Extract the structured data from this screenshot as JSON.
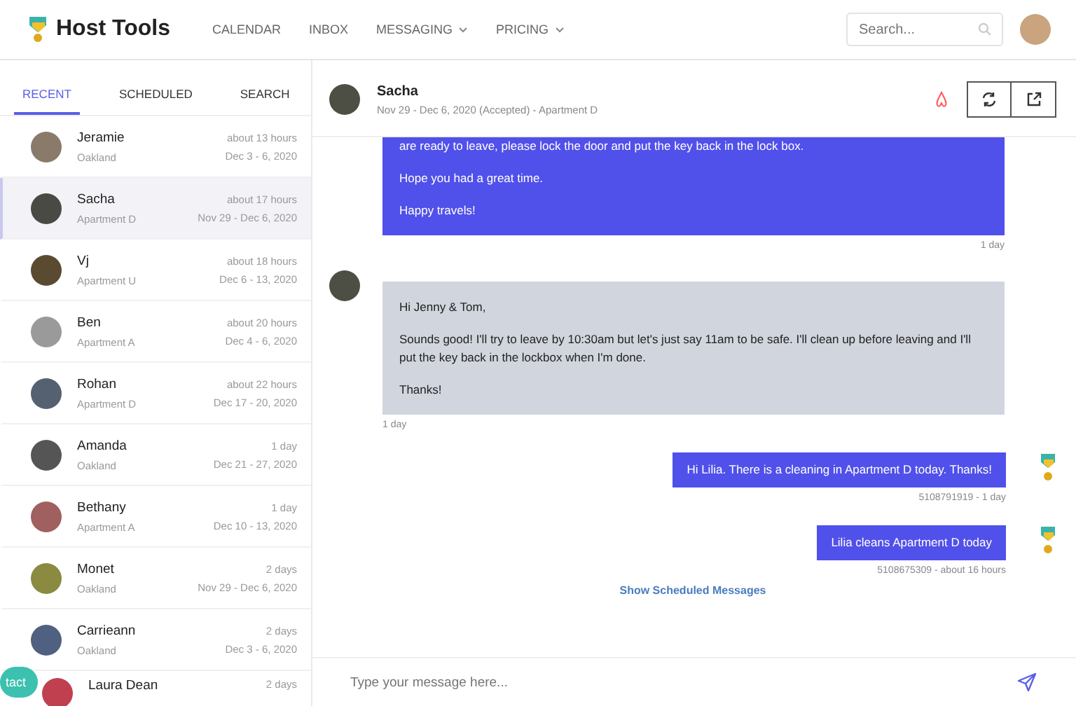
{
  "brand": {
    "name": "Host Tools"
  },
  "nav": [
    {
      "label": "CALENDAR",
      "dropdown": false
    },
    {
      "label": "INBOX",
      "dropdown": false
    },
    {
      "label": "MESSAGING",
      "dropdown": true
    },
    {
      "label": "PRICING",
      "dropdown": true
    }
  ],
  "search": {
    "placeholder": "Search..."
  },
  "tabs": [
    {
      "label": "RECENT",
      "selected": true
    },
    {
      "label": "SCHEDULED",
      "selected": false
    },
    {
      "label": "SEARCH",
      "selected": false
    }
  ],
  "conversations": [
    {
      "name": "Jeramie",
      "location": "Oakland",
      "time": "about 13 hours",
      "dates": "Dec 3 - 6, 2020",
      "selected": false
    },
    {
      "name": "Sacha",
      "location": "Apartment D",
      "time": "about 17 hours",
      "dates": "Nov 29 - Dec 6, 2020",
      "selected": true
    },
    {
      "name": "Vj",
      "location": "Apartment U",
      "time": "about 18 hours",
      "dates": "Dec 6 - 13, 2020",
      "selected": false
    },
    {
      "name": "Ben",
      "location": "Apartment A",
      "time": "about 20 hours",
      "dates": "Dec 4 - 6, 2020",
      "selected": false
    },
    {
      "name": "Rohan",
      "location": "Apartment D",
      "time": "about 22 hours",
      "dates": "Dec 17 - 20, 2020",
      "selected": false
    },
    {
      "name": "Amanda",
      "location": "Oakland",
      "time": "1 day",
      "dates": "Dec 21 - 27, 2020",
      "selected": false
    },
    {
      "name": "Bethany",
      "location": "Apartment A",
      "time": "1 day",
      "dates": "Dec 10 - 13, 2020",
      "selected": false
    },
    {
      "name": "Monet",
      "location": "Oakland",
      "time": "2 days",
      "dates": "Nov 29 - Dec 6, 2020",
      "selected": false
    },
    {
      "name": "Carrieann",
      "location": "Oakland",
      "time": "2 days",
      "dates": "Dec 3 - 6, 2020",
      "selected": false
    },
    {
      "name": "Laura Dean",
      "time": "2 days",
      "selected": false
    }
  ],
  "contact_tab": {
    "label": "tact"
  },
  "thread": {
    "name": "Sacha",
    "details": "Nov 29 - Dec 6, 2020 (Accepted) - Apartment D"
  },
  "messages": [
    {
      "kind": "outgoing",
      "paragraphs": [
        "are ready to leave, please lock the door and put the key back in the lock box.",
        "Hope you had a great time.",
        "Happy travels!"
      ],
      "meta": "1 day"
    },
    {
      "kind": "incoming",
      "paragraphs": [
        "Hi Jenny & Tom,",
        "Sounds good! I'll try to leave by 10:30am but let's just say 11am to be safe. I'll clean up before leaving and I'll put the key back in the lockbox when I'm done.",
        "Thanks!"
      ],
      "meta": "1 day"
    },
    {
      "kind": "sms",
      "paragraphs": [
        "Hi Lilia. There is a cleaning in Apartment D today. Thanks!"
      ],
      "meta": "5108791919 - 1 day"
    },
    {
      "kind": "sms",
      "paragraphs": [
        "Lilia cleans Apartment D today"
      ],
      "meta": "5108675309 - about 16 hours"
    }
  ],
  "scheduled_link": "Show Scheduled Messages",
  "composer": {
    "placeholder": "Type your message here..."
  }
}
